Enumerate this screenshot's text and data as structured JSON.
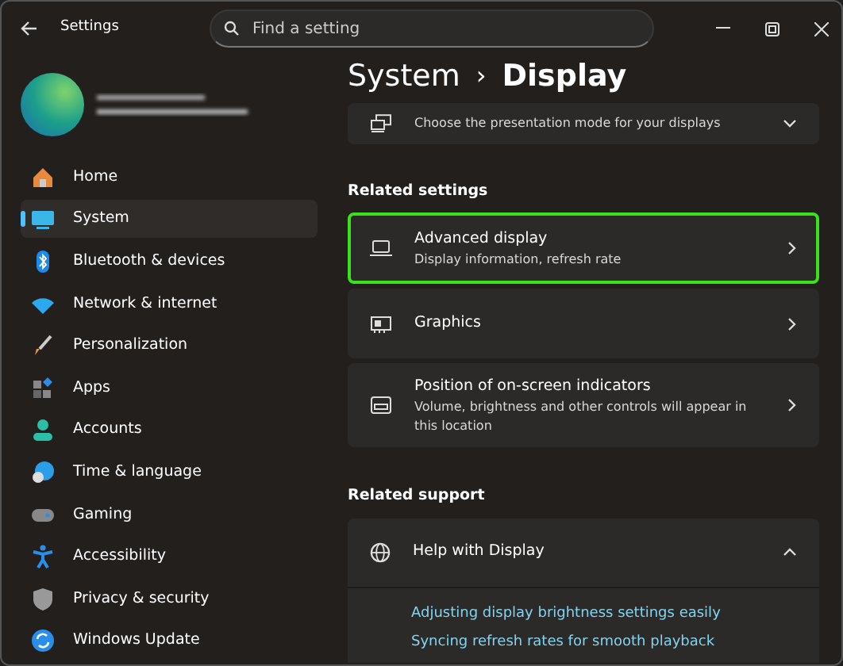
{
  "window": {
    "title": "Settings"
  },
  "search": {
    "placeholder": "Find a setting"
  },
  "sidebar": {
    "items": [
      {
        "label": "Home",
        "selected": false
      },
      {
        "label": "System",
        "selected": true
      },
      {
        "label": "Bluetooth & devices",
        "selected": false
      },
      {
        "label": "Network & internet",
        "selected": false
      },
      {
        "label": "Personalization",
        "selected": false
      },
      {
        "label": "Apps",
        "selected": false
      },
      {
        "label": "Accounts",
        "selected": false
      },
      {
        "label": "Time & language",
        "selected": false
      },
      {
        "label": "Gaming",
        "selected": false
      },
      {
        "label": "Accessibility",
        "selected": false
      },
      {
        "label": "Privacy & security",
        "selected": false
      },
      {
        "label": "Windows Update",
        "selected": false
      }
    ]
  },
  "breadcrumb": {
    "parent": "System",
    "separator": "›",
    "current": "Display"
  },
  "partial_card": {
    "description": "Choose the presentation mode for your displays"
  },
  "related_settings": {
    "heading": "Related settings",
    "cards": [
      {
        "title": "Advanced display",
        "description": "Display information, refresh rate",
        "highlighted": true
      },
      {
        "title": "Graphics",
        "highlighted": false
      },
      {
        "title": "Position of on-screen indicators",
        "description": "Volume, brightness and other controls will appear in this location",
        "highlighted": false
      }
    ]
  },
  "related_support": {
    "heading": "Related support",
    "title": "Help with Display",
    "expanded": true,
    "links": [
      "Adjusting display brightness settings easily",
      "Syncing refresh rates for smooth playback"
    ]
  }
}
